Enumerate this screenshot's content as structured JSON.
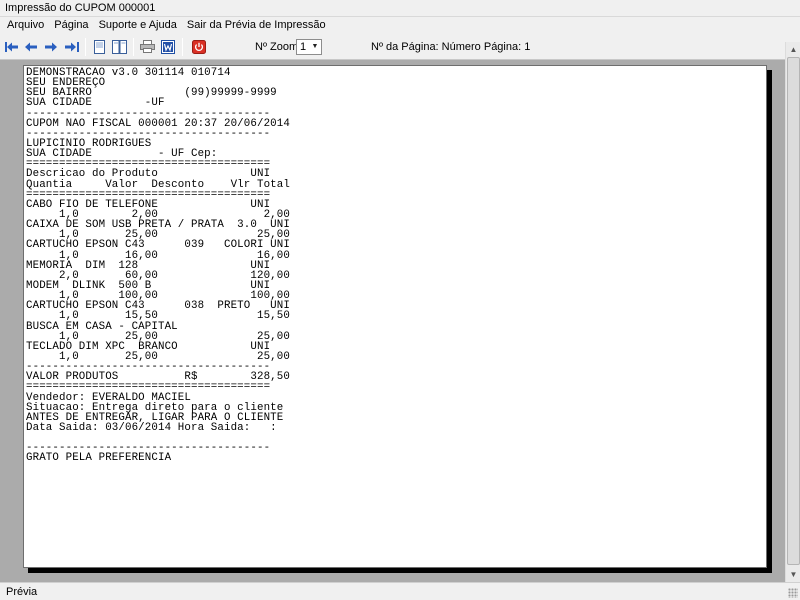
{
  "window": {
    "title": "Impressão do CUPOM 000001"
  },
  "menu": [
    "Arquivo",
    "Página",
    "Suporte e Ajuda",
    "Sair da Prévia de Impressão"
  ],
  "toolbar": {
    "zoom_label": "Nº Zoom",
    "zoom_value": "1",
    "page_label": "Nº da Página: Número Página: 1"
  },
  "receipt_lines": [
    "DEMONSTRACAO v3.0 301114 010714",
    "SEU ENDEREÇO",
    "SEU BAIRRO              (99)99999-9999",
    "SUA CIDADE        -UF",
    "-------------------------------------",
    "CUPOM NAO FISCAL 000001 20:37 20/06/2014",
    "-------------------------------------",
    "LUPICINIO RODRIGUES",
    "SUA CIDADE          - UF Cep:",
    "=====================================",
    "Descricao do Produto              UNI",
    "Quantia     Valor  Desconto    Vlr Total",
    "=====================================",
    "CABO FIO DE TELEFONE              UNI",
    "     1,0        2,00                2,00",
    "CAIXA DE SOM USB PRETA / PRATA  3.0  UNI",
    "     1,0       25,00               25,00",
    "CARTUCHO EPSON C43      039   COLORI UNI",
    "     1,0       16,00               16,00",
    "MEMORIA  DIM  128                 UNI",
    "     2,0       60,00              120,00",
    "MODEM  DLINK  500 B               UNI",
    "     1,0      100,00              100,00",
    "CARTUCHO EPSON C43      038  PRETO   UNI",
    "     1,0       15,50               15,50",
    "BUSCA EM CASA - CAPITAL",
    "     1,0       25,00               25,00",
    "TECLADO DIM XPC  BRANCO           UNI",
    "     1,0       25,00               25,00",
    "-------------------------------------",
    "VALOR PRODUTOS          R$        328,50",
    "=====================================",
    "Vendedor: EVERALDO MACIEL",
    "Situacao: Entrega direto para o cliente",
    "ANTES DE ENTREGAR, LIGAR PARA O CLIENTE",
    "Data Saida: 03/06/2014 Hora Saida:   :",
    "",
    "-------------------------------------",
    "GRATO PELA PREFERENCIA"
  ],
  "status": {
    "text": "Prévia"
  },
  "colors": {
    "chrome": "#f0f0f0",
    "preview_bg": "#ababab",
    "nav_blue": "#2a5fbf",
    "power_red": "#d93025"
  },
  "icons": [
    "first-page-icon",
    "previous-page-icon",
    "next-page-icon",
    "last-page-icon",
    "single-page-icon",
    "two-pages-icon",
    "print-icon",
    "word-export-icon",
    "power-icon"
  ]
}
